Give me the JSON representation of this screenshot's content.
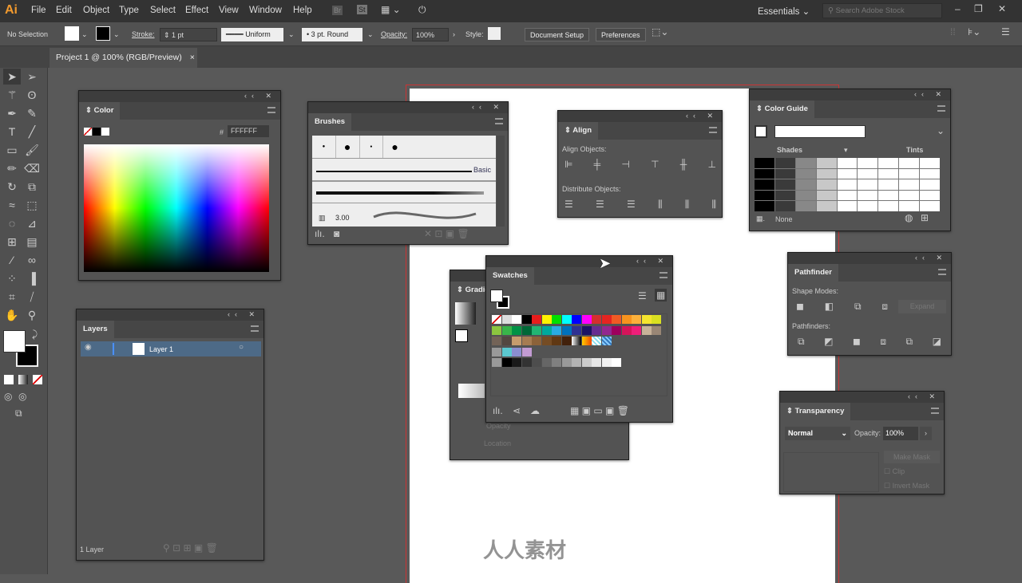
{
  "app": {
    "logo": "Ai",
    "menu": [
      "File",
      "Edit",
      "Object",
      "Type",
      "Select",
      "Effect",
      "View",
      "Window",
      "Help"
    ],
    "bridge": "Br",
    "stock": "St",
    "workspace": "Essentials",
    "search_placeholder": "Search Adobe Stock"
  },
  "control": {
    "selection": "No Selection",
    "stroke_label": "Stroke:",
    "stroke_value": "1 pt",
    "profile": "Uniform",
    "brush": "3 pt. Round",
    "opacity_label": "Opacity:",
    "opacity": "100%",
    "style_label": "Style:",
    "document_setup": "Document Setup",
    "preferences": "Preferences"
  },
  "document_tab": {
    "title": "Project 1 @ 100% (RGB/Preview)",
    "close": "×"
  },
  "tools": [
    "selection",
    "direct-selection",
    "magic-wand",
    "lasso",
    "pen",
    "curvature",
    "type",
    "line",
    "rectangle",
    "paintbrush",
    "pencil",
    "eraser",
    "rotate",
    "scale",
    "warp",
    "free-transform",
    "shape-builder",
    "perspective-grid",
    "mesh",
    "gradient",
    "eyedropper",
    "blend",
    "symbol-sprayer",
    "column-graph",
    "artboard",
    "slice",
    "hand",
    "zoom"
  ],
  "color_panel": {
    "title": "Color",
    "hex_label": "#",
    "hex": "FFFFFF"
  },
  "layers_panel": {
    "title": "Layers",
    "layer": "Layer 1",
    "footer": "1 Layer"
  },
  "brushes_panel": {
    "title": "Brushes",
    "basic": "Basic",
    "size": "3.00"
  },
  "align_panel": {
    "title": "Align",
    "align_objects": "Align Objects:",
    "distribute_objects": "Distribute Objects:"
  },
  "color_guide": {
    "title": "Color Guide",
    "shades": "Shades",
    "tints": "Tints",
    "none": "None"
  },
  "gradient_panel": {
    "title": "Gradient",
    "opacity": "Opacity",
    "location": "Location"
  },
  "swatches": {
    "title": "Swatches",
    "rows": [
      [
        "none",
        "reg",
        "#ffffff",
        "#000000",
        "#e81c1c",
        "#fff200",
        "#00e000",
        "#00ffff",
        "#0000ff",
        "#ff00ff",
        "#d42e2e",
        "#e52421",
        "#f15a24",
        "#f7931e",
        "#fbb03b",
        "#f5e52e",
        "#d9e021"
      ],
      [
        "#8cc63f",
        "#39b54a",
        "#009245",
        "#006837",
        "#22b573",
        "#00a99d",
        "#29abe2",
        "#0071bc",
        "#2e3192",
        "#1b1464",
        "#662d91",
        "#93278f",
        "#9e005d",
        "#d4145a",
        "#ed1e79",
        "#c7b299",
        "#998675"
      ],
      [
        "#736357",
        "#534741",
        "#c69c6d",
        "#a67c52",
        "#8c6239",
        "#754c24",
        "#603813",
        "#42210b",
        "grad-bw",
        "grad-orange",
        "pattern",
        "pattern2"
      ],
      [
        "folder",
        "#5bc8d0",
        "#8a8ed0",
        "#c39bd3"
      ],
      [
        "folder",
        "#000000",
        "#1a1a1a",
        "#333333",
        "#4d4d4d",
        "#666666",
        "#808080",
        "#999999",
        "#b3b3b3",
        "#cccccc",
        "#e6e6e6",
        "#f2f2f2",
        "#ffffff"
      ]
    ]
  },
  "pathfinder": {
    "title": "Pathfinder",
    "shape_modes": "Shape Modes:",
    "pathfinders": "Pathfinders:",
    "expand": "Expand"
  },
  "transparency": {
    "title": "Transparency",
    "blend_mode": "Normal",
    "opacity_label": "Opacity:",
    "opacity": "100%",
    "make_mask": "Make Mask",
    "clip": "Clip",
    "invert_mask": "Invert Mask"
  },
  "watermark": "人人素材"
}
